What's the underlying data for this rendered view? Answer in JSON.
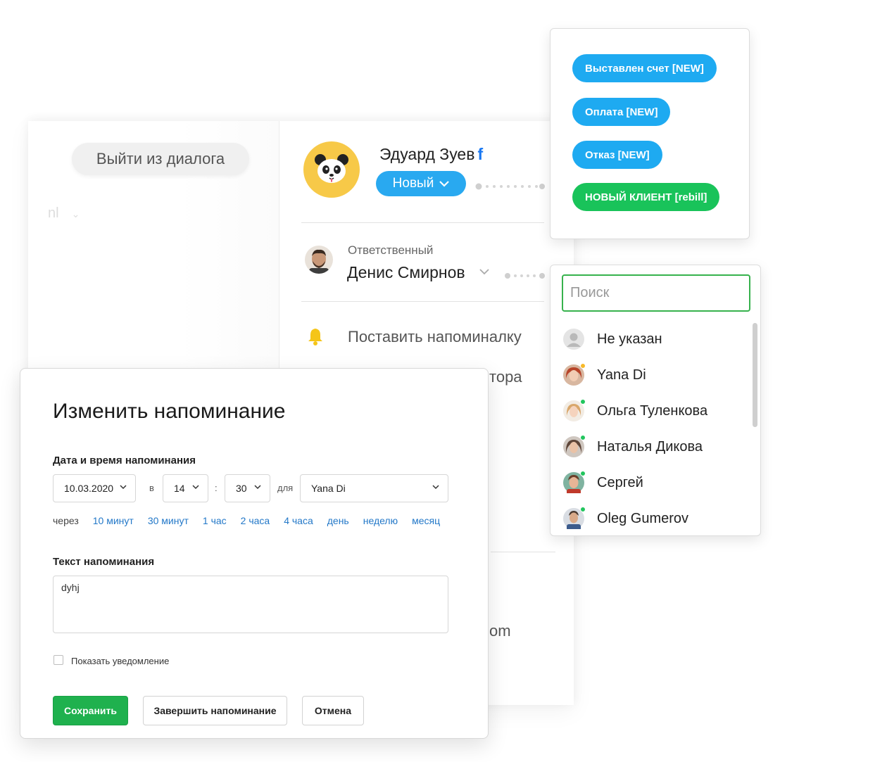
{
  "dialog": {
    "exit_label": "Выйти из диалога",
    "faded_select": "nl"
  },
  "customer": {
    "name": "Эдуард Зуев",
    "social_icon": "facebook-icon",
    "status_label": "Новый"
  },
  "responsible": {
    "label": "Ответственный",
    "name": "Денис Смирнов"
  },
  "reminder_action": "Поставить напоминалку",
  "partial_texts": [
    "тора",
    "om"
  ],
  "tags": [
    {
      "label": "Выставлен счет [NEW]",
      "color": "#1eaaf1"
    },
    {
      "label": "Оплата [NEW]",
      "color": "#1eaaf1"
    },
    {
      "label": "Отказ [NEW]",
      "color": "#1eaaf1"
    },
    {
      "label": "НОВЫЙ КЛИЕНТ [rebill]",
      "color": "#19c35a"
    }
  ],
  "user_picker": {
    "search_placeholder": "Поиск",
    "users": [
      {
        "name": "Не указан",
        "status": "none"
      },
      {
        "name": "Yana Di",
        "status": "away"
      },
      {
        "name": "Ольга Туленкова",
        "status": "online"
      },
      {
        "name": "Наталья Дикова",
        "status": "online"
      },
      {
        "name": "Сергей",
        "status": "online"
      },
      {
        "name": "Oleg Gumerov",
        "status": "online"
      }
    ]
  },
  "modal": {
    "title": "Изменить напоминание",
    "datetime_label": "Дата и время напоминания",
    "date": "10.03.2020",
    "at_label": "в",
    "hour": "14",
    "colon": ":",
    "minute": "30",
    "for_label": "для",
    "assignee": "Yana Di",
    "quick_label": "через",
    "quick_options": [
      "10 минут",
      "30 минут",
      "1 час",
      "2 часа",
      "4 часа",
      "день",
      "неделю",
      "месяц"
    ],
    "text_label": "Текст напоминания",
    "text_value": "dyhj",
    "notify_label": "Показать уведомление",
    "notify_checked": false,
    "save_label": "Сохранить",
    "finish_label": "Завершить напоминание",
    "cancel_label": "Отмена"
  },
  "colors": {
    "accent_blue": "#29a9f0",
    "save_green": "#1fb14e",
    "search_border": "#37b24d",
    "link_blue": "#2378c8"
  }
}
